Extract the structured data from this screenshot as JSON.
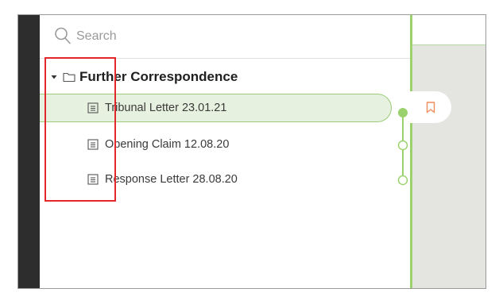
{
  "search": {
    "placeholder": "Search",
    "value": ""
  },
  "tree": {
    "folder": {
      "label": "Further Correspondence",
      "expanded": true
    },
    "documents": [
      {
        "label": "Tribunal Letter 23.01.21",
        "selected": true
      },
      {
        "label": "Opening Claim 12.08.20",
        "selected": false
      },
      {
        "label": "Response Letter 28.08.20",
        "selected": false
      }
    ]
  },
  "icons": {
    "search": "search-icon",
    "caret": "caret-down-icon",
    "folder": "folder-icon",
    "document": "document-icon",
    "bookmark": "bookmark-icon"
  },
  "colors": {
    "accent_green": "#9bd26e",
    "selected_bg": "#e7f1df",
    "highlight_red": "#e3282c",
    "bookmark_orange": "#f08c5a",
    "dark_strip": "#2d2d2d"
  }
}
